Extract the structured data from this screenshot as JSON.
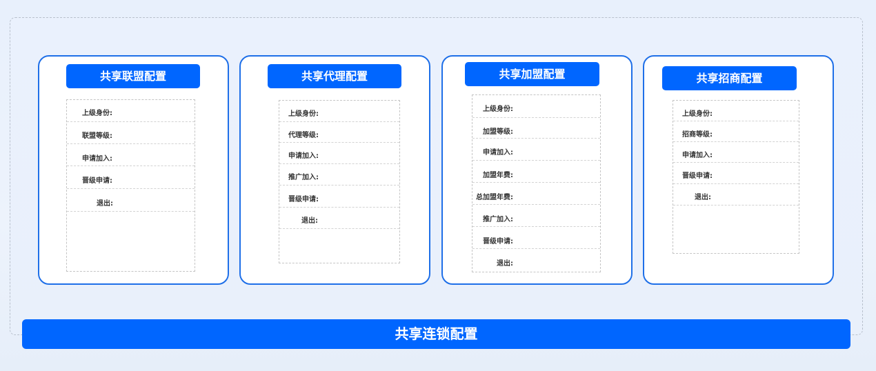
{
  "cards": [
    {
      "title": "共享联盟配置",
      "rows": [
        "上级身份:",
        "联盟等级:",
        "申请加入:",
        "晋级申请:",
        "退出:"
      ]
    },
    {
      "title": "共享代理配置",
      "rows": [
        "上级身份:",
        "代理等级:",
        "申请加入:",
        "推广加入:",
        "晋级申请:",
        "退出:"
      ]
    },
    {
      "title": "共享加盟配置",
      "rows": [
        "上级身份:",
        "加盟等级:",
        "申请加入:",
        "加盟年费:",
        "总加盟年费:",
        "推广加入:",
        "晋级申请:",
        "退出:"
      ]
    },
    {
      "title": "共享招商配置",
      "rows": [
        "上级身份:",
        "招商等级:",
        "申请加入:",
        "晋级申请:",
        "退出:"
      ]
    }
  ],
  "footer": {
    "title": "共享连锁配置"
  },
  "colors": {
    "accent": "#0066ff",
    "card_border": "#1e6fe8",
    "dashed_border": "#c4c4c4"
  }
}
